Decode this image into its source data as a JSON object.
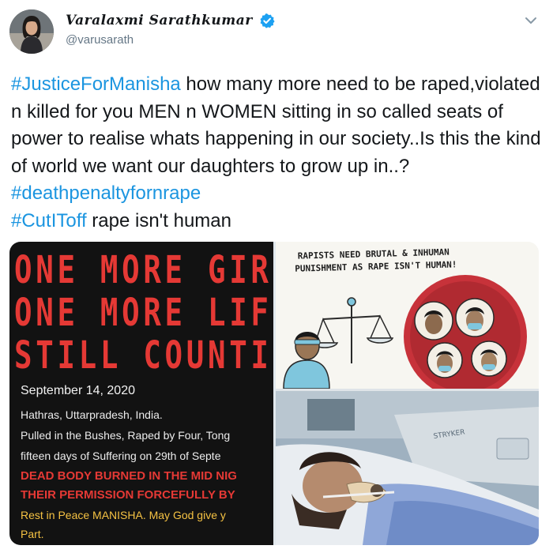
{
  "author": {
    "display_name": "Varalaxmi Sarathkumar",
    "handle": "@varusarath",
    "verified": true,
    "avatar_icon": "user-avatar",
    "more_icon": "chevron-down-icon"
  },
  "tweet": {
    "hashtag_1": "#JusticeForManisha",
    "text_1": " how many more need to be raped,violated n killed for you MEN n WOMEN sitting in so called seats of power to realise whats happening in our society..Is this the kind of world we want our daughters to grow up in..? ",
    "hashtag_2": "#deathpenaltyfornrape",
    "hashtag_3": "#CutIToff",
    "text_2": " rape isn't human"
  },
  "media": {
    "poster": {
      "headline_1": "ONE MORE GIR",
      "headline_2": "ONE MORE LIF",
      "headline_3": "STILL COUNTI",
      "date": "September 14, 2020",
      "location": "Hathras, Uttarpradesh, India.",
      "detail_1": "Pulled in the Bushes, Raped by Four, Tong",
      "detail_2": "fifteen days of Suffering on 29th of Septe",
      "red_1": "DEAD BODY BURNED IN THE MID NIG",
      "red_2": "THEIR PERMISSION FORCEFULLY BY",
      "rip_1": "Rest in Peace MANISHA. May God give y",
      "rip_2": "Part."
    },
    "cartoon": {
      "caption_1": "RAPISTS NEED BRUTAL & INHUMAN",
      "caption_2": "PUNISHMENT AS RAPE ISN'T HUMAN!"
    },
    "photo": {
      "bed_label": "STRYKER"
    }
  },
  "colors": {
    "link": "#1b95e0",
    "verified": "#1da1f2",
    "poster_red": "#e53935",
    "poster_gold": "#f5c243"
  }
}
